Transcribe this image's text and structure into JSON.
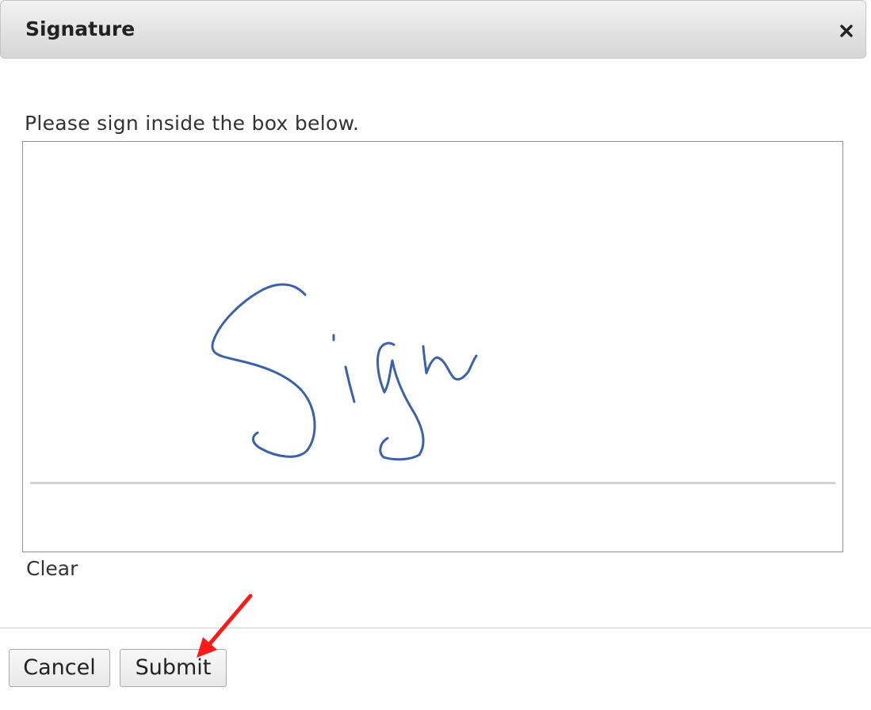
{
  "dialog": {
    "title": "Signature",
    "close_icon": "close-icon"
  },
  "body": {
    "instructions": "Please sign inside the box below.",
    "clear_label": "Clear"
  },
  "footer": {
    "cancel_label": "Cancel",
    "submit_label": "Submit"
  },
  "colors": {
    "signature_ink": "#3b62a5",
    "annotation_arrow": "#ff1a1a"
  }
}
